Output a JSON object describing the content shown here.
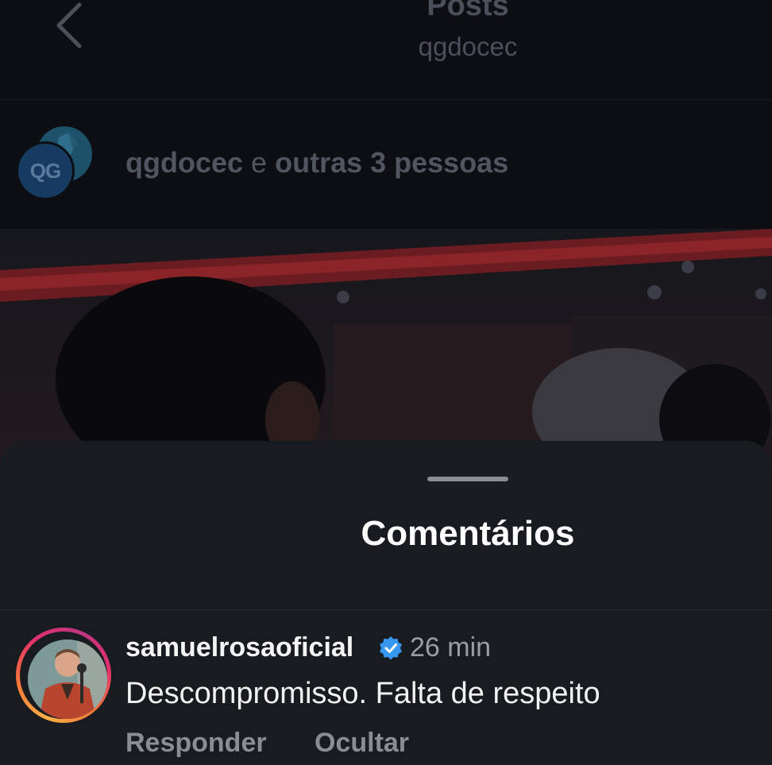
{
  "header": {
    "title": "Posts",
    "subtitle": "qgdocec"
  },
  "collab": {
    "primary_user": "qgdocec",
    "connector": "e",
    "others": "outras 3 pessoas",
    "avatar_text": "QG"
  },
  "comments_sheet": {
    "title": "Comentários",
    "comments": [
      {
        "username": "samuelrosaoficial",
        "verified": true,
        "time": "26 min",
        "text": "Descompromisso. Falta de respeito",
        "reply_label": "Responder",
        "hide_label": "Ocultar"
      }
    ]
  },
  "icons": [
    "back-icon",
    "verified-badge-icon"
  ],
  "colors": {
    "sheet_bg": "#181b20",
    "page_bg": "#0b0d12",
    "verified_blue": "#3897f0",
    "muted_text": "#8a8d93"
  }
}
